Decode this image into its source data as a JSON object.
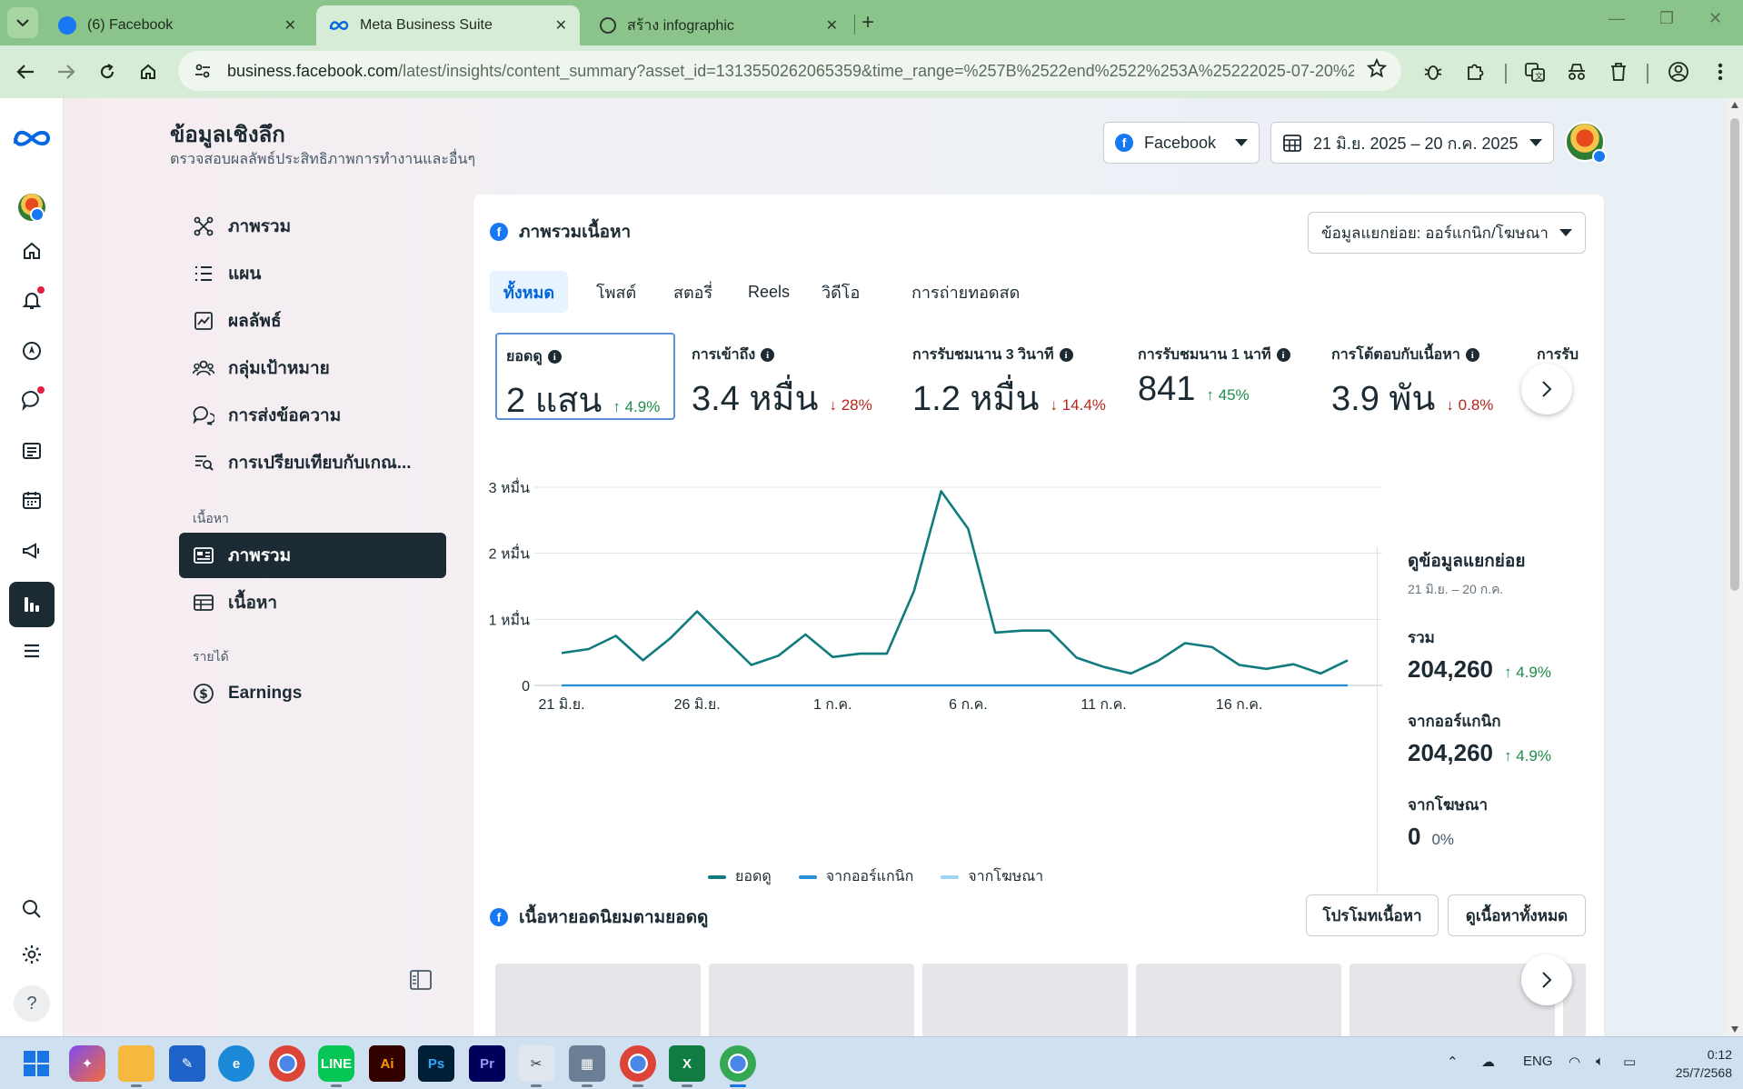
{
  "browser": {
    "tabs": [
      {
        "title": "(6) Facebook",
        "icon": "facebook-icon"
      },
      {
        "title": "Meta Business Suite",
        "icon": "meta-icon",
        "active": true
      },
      {
        "title": "สร้าง infographic",
        "icon": "chatgpt-icon"
      }
    ],
    "url_host": "business.facebook.com",
    "url_path": "/latest/insights/content_summary?asset_id=131355026206535​9&time_range=%257B%2522end%2522%253A%25222025-07-20%2522%..."
  },
  "header": {
    "title": "ข้อมูลเชิงลึก",
    "subtitle": "ตรวจสอบผลลัพธ์ประสิทธิภาพการทำงานและอื่นๆ",
    "platform": "Facebook",
    "date_range": "21 มิ.ย. 2025 – 20 ก.ค. 2025"
  },
  "subnav": {
    "items": [
      {
        "label": "ภาพรวม",
        "icon": "network-icon"
      },
      {
        "label": "แผน",
        "icon": "list-icon"
      },
      {
        "label": "ผลลัพธ์",
        "icon": "trend-chart-icon"
      },
      {
        "label": "กลุ่มเป้าหมาย",
        "icon": "people-icon"
      },
      {
        "label": "การส่งข้อความ",
        "icon": "chat-bubble-icon"
      },
      {
        "label": "การเปรียบเทียบกับเกณ...",
        "icon": "benchmark-icon"
      }
    ],
    "section_content": "เนื้อหา",
    "content_items": [
      {
        "label": "ภาพรวม",
        "icon": "dashboard-icon",
        "active": true
      },
      {
        "label": "เนื้อหา",
        "icon": "table-icon"
      }
    ],
    "section_income": "รายได้",
    "income_items": [
      {
        "label": "Earnings",
        "icon": "dollar-circle-icon"
      }
    ]
  },
  "card": {
    "title": "ภาพรวมเนื้อหา",
    "breakdown": "ข้อมูลแยกย่อย: ออร์แกนิก/โฆษณา",
    "tabs": [
      "ทั้งหมด",
      "โพสต์",
      "สตอรี่",
      "Reels",
      "วิดีโอ",
      "การถ่ายทอดสด"
    ],
    "metrics": [
      {
        "label": "ยอดดู",
        "value": "2 แสน",
        "change": "4.9%",
        "dir": "up"
      },
      {
        "label": "การเข้าถึง",
        "value": "3.4 หมื่น",
        "change": "28%",
        "dir": "down"
      },
      {
        "label": "การรับชมนาน 3 วินาที",
        "value": "1.2 หมื่น",
        "change": "14.4%",
        "dir": "down"
      },
      {
        "label": "การรับชมนาน 1 นาที",
        "value": "841",
        "change": "45%",
        "dir": "up"
      },
      {
        "label": "การโต้ตอบกับเนื้อหา",
        "value": "3.9 พัน",
        "change": "0.8%",
        "dir": "down"
      }
    ],
    "metric_partial_label": "การรับ",
    "side": {
      "title": "ดูข้อมูลแยกย่อย",
      "range": "21 มิ.ย. – 20 ก.ค.",
      "total_label": "รวม",
      "total_value": "204,260",
      "total_change": "4.9%",
      "organic_label": "จากออร์แกนิก",
      "organic_value": "204,260",
      "organic_change": "4.9%",
      "ads_label": "จากโฆษณา",
      "ads_value": "0",
      "ads_change": "0%"
    },
    "top_title": "เนื้อหายอดนิยมตามยอดดู",
    "promote_btn": "โปรโมทเนื้อหา",
    "view_all_btn": "ดูเนื้อหาทั้งหมด"
  },
  "chart_data": {
    "type": "line",
    "x_ticks": [
      "21 มิ.ย.",
      "26 มิ.ย.",
      "1 ก.ค.",
      "6 ก.ค.",
      "11 ก.ค.",
      "16 ก.ค."
    ],
    "y_ticks": [
      "0",
      "1 หมื่น",
      "2 หมื่น",
      "3 หมื่น"
    ],
    "ylim": [
      0,
      30000
    ],
    "x": [
      "21 มิ.ย.",
      "22 มิ.ย.",
      "23 มิ.ย.",
      "24 มิ.ย.",
      "25 มิ.ย.",
      "26 มิ.ย.",
      "27 มิ.ย.",
      "28 มิ.ย.",
      "29 มิ.ย.",
      "30 มิ.ย.",
      "1 ก.ค.",
      "2 ก.ค.",
      "3 ก.ค.",
      "4 ก.ค.",
      "5 ก.ค.",
      "6 ก.ค.",
      "7 ก.ค.",
      "8 ก.ค.",
      "9 ก.ค.",
      "10 ก.ค.",
      "11 ก.ค.",
      "12 ก.ค.",
      "13 ก.ค.",
      "14 ก.ค.",
      "15 ก.ค.",
      "16 ก.ค.",
      "17 ก.ค.",
      "18 ก.ค.",
      "19 ก.ค.",
      "20 ก.ค."
    ],
    "series": [
      {
        "name": "ยอดดู",
        "color": "#0f7b7d",
        "values": [
          4900,
          5500,
          7500,
          3800,
          7100,
          11200,
          7100,
          3100,
          4500,
          7700,
          4300,
          4800,
          4800,
          14300,
          29400,
          23700,
          8000,
          8300,
          8300,
          4200,
          2800,
          1800,
          3700,
          6400,
          5800,
          3100,
          2500,
          3200,
          1800,
          3800
        ]
      },
      {
        "name": "จากออร์แกนิก",
        "color": "#2a8fd6",
        "values": [
          0,
          0,
          0,
          0,
          0,
          0,
          0,
          0,
          0,
          0,
          0,
          0,
          0,
          0,
          0,
          0,
          0,
          0,
          0,
          0,
          0,
          0,
          0,
          0,
          0,
          0,
          0,
          0,
          0,
          0
        ]
      },
      {
        "name": "จากโฆษณา",
        "color": "#9fd4f2",
        "values": [
          0,
          0,
          0,
          0,
          0,
          0,
          0,
          0,
          0,
          0,
          0,
          0,
          0,
          0,
          0,
          0,
          0,
          0,
          0,
          0,
          0,
          0,
          0,
          0,
          0,
          0,
          0,
          0,
          0,
          0
        ]
      }
    ],
    "grid": true,
    "legend": "bottom"
  },
  "taskbar": {
    "lang": "ENG",
    "time": "0:12",
    "date": "25/7/2568"
  }
}
